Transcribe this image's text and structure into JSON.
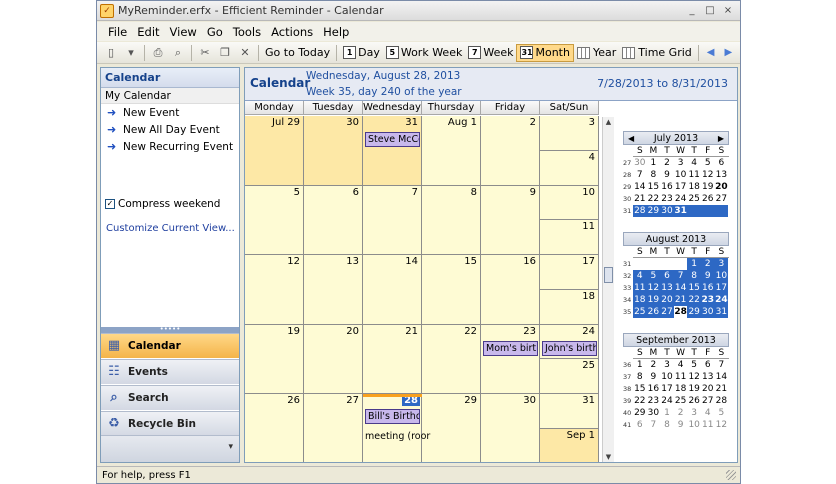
{
  "window": {
    "title": "MyReminder.erfx - Efficient Reminder - Calendar",
    "controls": [
      "_",
      "□",
      "×"
    ]
  },
  "menu": [
    "File",
    "Edit",
    "View",
    "Go",
    "Tools",
    "Actions",
    "Help"
  ],
  "toolbar": {
    "go_today": "Go to Today",
    "day": "Day",
    "work_week": "Work Week",
    "week": "Week",
    "month": "Month",
    "year": "Year",
    "time_grid": "Time Grid",
    "day_num": "1",
    "work_week_num": "5",
    "week_num": "7",
    "month_num": "31"
  },
  "nav": {
    "header": "Calendar",
    "my_calendar": "My Calendar",
    "tasks": [
      "New Event",
      "New All Day Event",
      "New Recurring Event"
    ],
    "compress_weekend": "Compress weekend",
    "customize": "Customize Current View...",
    "buttons": [
      "Calendar",
      "Events",
      "Search",
      "Recycle Bin"
    ],
    "active": "Calendar"
  },
  "calendar": {
    "title": "Calendar",
    "date_line": "Wednesday, August 28, 2013",
    "week_line": "Week 35, day 240 of the year",
    "range": "7/28/2013 to 8/31/2013",
    "day_headers": [
      "Monday",
      "Tuesday",
      "Wednesday",
      "Thursday",
      "Friday",
      "Sat/Sun"
    ],
    "weeks": [
      {
        "days": [
          "Jul 29",
          "30",
          "31",
          "Aug 1",
          "2"
        ],
        "sat": "3",
        "sun": "4",
        "other": [
          true,
          true,
          true,
          false,
          false
        ]
      },
      {
        "days": [
          "5",
          "6",
          "7",
          "8",
          "9"
        ],
        "sat": "10",
        "sun": "11",
        "other": [
          false,
          false,
          false,
          false,
          false
        ]
      },
      {
        "days": [
          "12",
          "13",
          "14",
          "15",
          "16"
        ],
        "sat": "17",
        "sun": "18",
        "other": [
          false,
          false,
          false,
          false,
          false
        ]
      },
      {
        "days": [
          "19",
          "20",
          "21",
          "22",
          "23"
        ],
        "sat": "24",
        "sun": "25",
        "other": [
          false,
          false,
          false,
          false,
          false
        ]
      },
      {
        "days": [
          "26",
          "27",
          "28",
          "29",
          "30"
        ],
        "sat": "31",
        "sun": "Sep 1",
        "other": [
          false,
          false,
          false,
          false,
          false
        ]
      }
    ],
    "events": {
      "steve": "Steve McCor",
      "mom": "Mom's birthd",
      "john": "John's birthd",
      "bill": "Bill's Birthday",
      "meeting": "meeting (roor"
    }
  },
  "mini_calendars": [
    {
      "title": "July 2013",
      "dow": [
        "S",
        "M",
        "T",
        "W",
        "T",
        "F",
        "S"
      ],
      "rows": [
        {
          "wk": "27",
          "days": [
            "30",
            "1",
            "2",
            "3",
            "4",
            "5",
            "6"
          ]
        },
        {
          "wk": "28",
          "days": [
            "7",
            "8",
            "9",
            "10",
            "11",
            "12",
            "13"
          ]
        },
        {
          "wk": "29",
          "days": [
            "14",
            "15",
            "16",
            "17",
            "18",
            "19",
            "20"
          ]
        },
        {
          "wk": "30",
          "days": [
            "21",
            "22",
            "23",
            "24",
            "25",
            "26",
            "27"
          ]
        },
        {
          "wk": "31",
          "days": [
            "28",
            "29",
            "30",
            "31",
            "",
            "",
            ""
          ]
        }
      ]
    },
    {
      "title": "August 2013",
      "dow": [
        "S",
        "M",
        "T",
        "W",
        "T",
        "F",
        "S"
      ],
      "rows": [
        {
          "wk": "31",
          "days": [
            "",
            "",
            "",
            "",
            "1",
            "2",
            "3"
          ]
        },
        {
          "wk": "32",
          "days": [
            "4",
            "5",
            "6",
            "7",
            "8",
            "9",
            "10"
          ]
        },
        {
          "wk": "33",
          "days": [
            "11",
            "12",
            "13",
            "14",
            "15",
            "16",
            "17"
          ]
        },
        {
          "wk": "34",
          "days": [
            "18",
            "19",
            "20",
            "21",
            "22",
            "23",
            "24"
          ]
        },
        {
          "wk": "35",
          "days": [
            "25",
            "26",
            "27",
            "28",
            "29",
            "30",
            "31"
          ]
        }
      ]
    },
    {
      "title": "September 2013",
      "dow": [
        "S",
        "M",
        "T",
        "W",
        "T",
        "F",
        "S"
      ],
      "rows": [
        {
          "wk": "36",
          "days": [
            "1",
            "2",
            "3",
            "4",
            "5",
            "6",
            "7"
          ]
        },
        {
          "wk": "37",
          "days": [
            "8",
            "9",
            "10",
            "11",
            "12",
            "13",
            "14"
          ]
        },
        {
          "wk": "38",
          "days": [
            "15",
            "16",
            "17",
            "18",
            "19",
            "20",
            "21"
          ]
        },
        {
          "wk": "39",
          "days": [
            "22",
            "23",
            "24",
            "25",
            "26",
            "27",
            "28"
          ]
        },
        {
          "wk": "40",
          "days": [
            "29",
            "30",
            "1",
            "2",
            "3",
            "4",
            "5"
          ]
        },
        {
          "wk": "41",
          "days": [
            "6",
            "7",
            "8",
            "9",
            "10",
            "11",
            "12"
          ]
        }
      ]
    }
  ],
  "status": "For help, press F1",
  "colors": {
    "accent": "#2d68c4",
    "cell": "#fefbd4",
    "other_month": "#fde8a6",
    "event": "#c8b8ec",
    "active_nav": "#f4b449"
  }
}
